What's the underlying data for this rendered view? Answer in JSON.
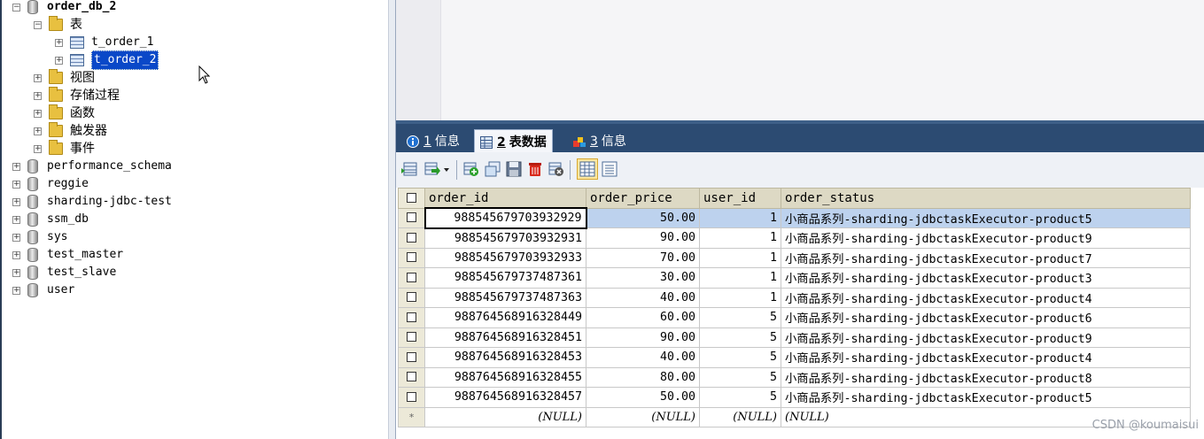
{
  "tree": {
    "db_current": "order_db_2",
    "folder_tables": "表",
    "tables": [
      "t_order_1",
      "t_order_2"
    ],
    "folder_views": "视图",
    "folder_procedures": "存储过程",
    "folder_functions": "函数",
    "folder_triggers": "触发器",
    "folder_events": "事件",
    "other_databases": [
      "performance_schema",
      "reggie",
      "sharding-jdbc-test",
      "ssm_db",
      "sys",
      "test_master",
      "test_slave",
      "user"
    ]
  },
  "tabs": [
    {
      "num": "1",
      "label": "信息",
      "icon": "info-icon"
    },
    {
      "num": "2",
      "label": "表数据",
      "icon": "table-data-icon"
    },
    {
      "num": "3",
      "label": "信息",
      "icon": "info-shapes-icon"
    }
  ],
  "toolbar_icons": [
    "insert-row-icon",
    "export-dropdown-icon",
    "add-row-icon",
    "duplicate-row-icon",
    "save-icon",
    "delete-icon",
    "cancel-changes-icon",
    "grid-view-icon",
    "text-view-icon"
  ],
  "grid": {
    "columns": [
      "order_id",
      "order_price",
      "user_id",
      "order_status"
    ],
    "rows": [
      [
        "988545679703932929",
        "50.00",
        "1",
        "小商品系列-sharding-jdbctaskExecutor-product5"
      ],
      [
        "988545679703932931",
        "90.00",
        "1",
        "小商品系列-sharding-jdbctaskExecutor-product9"
      ],
      [
        "988545679703932933",
        "70.00",
        "1",
        "小商品系列-sharding-jdbctaskExecutor-product7"
      ],
      [
        "988545679737487361",
        "30.00",
        "1",
        "小商品系列-sharding-jdbctaskExecutor-product3"
      ],
      [
        "988545679737487363",
        "40.00",
        "1",
        "小商品系列-sharding-jdbctaskExecutor-product4"
      ],
      [
        "988764568916328449",
        "60.00",
        "5",
        "小商品系列-sharding-jdbctaskExecutor-product6"
      ],
      [
        "988764568916328451",
        "90.00",
        "5",
        "小商品系列-sharding-jdbctaskExecutor-product9"
      ],
      [
        "988764568916328453",
        "40.00",
        "5",
        "小商品系列-sharding-jdbctaskExecutor-product4"
      ],
      [
        "988764568916328455",
        "80.00",
        "5",
        "小商品系列-sharding-jdbctaskExecutor-product8"
      ],
      [
        "988764568916328457",
        "50.00",
        "5",
        "小商品系列-sharding-jdbctaskExecutor-product5"
      ]
    ],
    "new_row_marker": "*",
    "null_label": "(NULL)"
  },
  "watermark": "CSDN @koumaisui",
  "colors": {
    "tabbar": "#2c4b72",
    "selection": "#0a48c8",
    "selected_row": "#bdd2ee",
    "header": "#ddd9c4"
  }
}
